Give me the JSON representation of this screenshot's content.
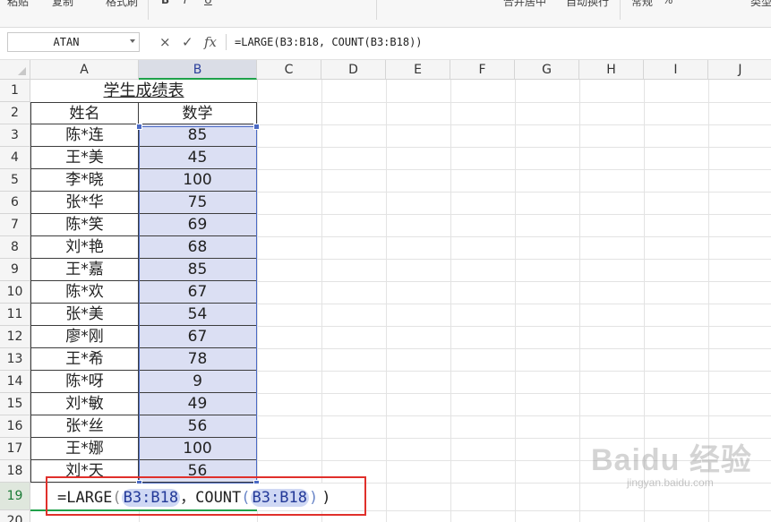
{
  "ribbon": {
    "items": [
      "粘贴",
      "复制",
      "格式刷",
      "B",
      "I",
      "U",
      "合并居中",
      "自动换行",
      "常规",
      "%",
      "类型"
    ]
  },
  "formula_bar": {
    "name_box": "ATAN",
    "cancel_icon": "×",
    "enter_icon": "✓",
    "fx_label": "fx",
    "formula": "=LARGE(B3:B18, COUNT(B3:B18))"
  },
  "columns": [
    "A",
    "B",
    "C",
    "D",
    "E",
    "F",
    "G",
    "H",
    "I",
    "J"
  ],
  "rows": [
    "1",
    "2",
    "3",
    "4",
    "5",
    "6",
    "7",
    "8",
    "9",
    "10",
    "11",
    "12",
    "13",
    "14",
    "15",
    "16",
    "17",
    "18",
    "19",
    "20"
  ],
  "sheet": {
    "title": "学生成绩表",
    "header_name": "姓名",
    "header_score": "数学",
    "students": [
      {
        "name": "陈*连",
        "score": "85"
      },
      {
        "name": "王*美",
        "score": "45"
      },
      {
        "name": "李*晓",
        "score": "100"
      },
      {
        "name": "张*华",
        "score": "75"
      },
      {
        "name": "陈*笑",
        "score": "69"
      },
      {
        "name": "刘*艳",
        "score": "68"
      },
      {
        "name": "王*嘉",
        "score": "85"
      },
      {
        "name": "陈*欢",
        "score": "67"
      },
      {
        "name": "张*美",
        "score": "54"
      },
      {
        "name": "廖*刚",
        "score": "67"
      },
      {
        "name": "王*希",
        "score": "78"
      },
      {
        "name": "陈*呀",
        "score": "9"
      },
      {
        "name": "刘*敏",
        "score": "49"
      },
      {
        "name": "张*丝",
        "score": "56"
      },
      {
        "name": "王*娜",
        "score": "100"
      },
      {
        "name": "刘*天",
        "score": "56"
      }
    ]
  },
  "editing": {
    "prefix": "=LARGE",
    "open1": "(",
    "range1": "B3:B18",
    "sep": "，",
    "func2": "COUNT",
    "open2": "(",
    "range2": "B3:B18",
    "close2": ")",
    "close1": ")"
  },
  "watermark": {
    "brand": "Baidu 经验",
    "url": "jingyan.baidu.com"
  },
  "colors": {
    "selection": "#dbdff3",
    "range_border": "#4b6ac4",
    "active_green": "#1fa14a",
    "highlight_box": "#e0302b"
  }
}
